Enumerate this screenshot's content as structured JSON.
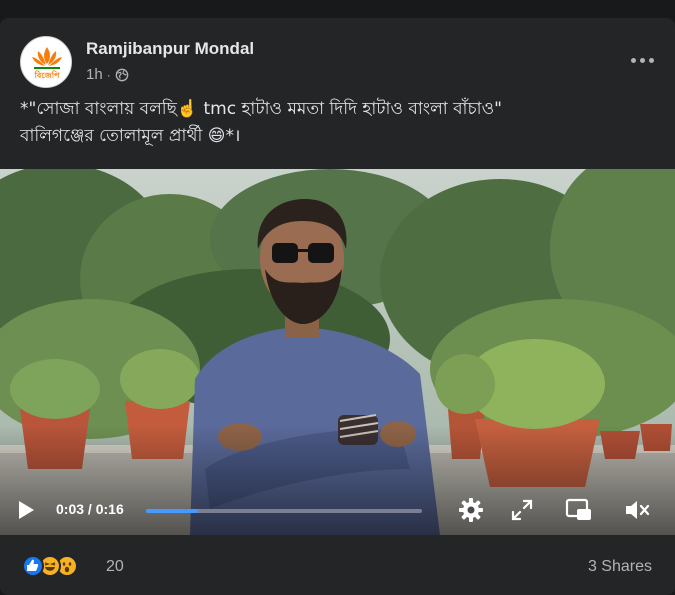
{
  "post": {
    "author": "Ramjibanpur Mondal",
    "time": "1h",
    "avatar_text": "বিজেপি",
    "caption_line1": "*\"সোজা বাংলায় বলছি☝️ tmc হাটাও মমতা দিদি হাটাও বাংলা বাঁচাও\"",
    "caption_line2": "বালিগঞ্জের তোলামূল প্রার্থী 😄*।"
  },
  "video": {
    "current_time": "0:03",
    "separator": "/",
    "duration": "0:16",
    "progress": 0.1875
  },
  "footer": {
    "reaction_count": "20",
    "shares": "3 Shares",
    "reactions": [
      "like-icon",
      "haha-icon",
      "wow-icon"
    ]
  },
  "colors": {
    "background": "#18191a",
    "card": "#242526",
    "text_primary": "#e4e6eb",
    "text_secondary": "#b0b3b8",
    "progress_fill": "#4599ff",
    "like_blue": "#1877f2",
    "emoji_yellow": "#f7b125",
    "bjp_saffron": "#f97d09"
  }
}
